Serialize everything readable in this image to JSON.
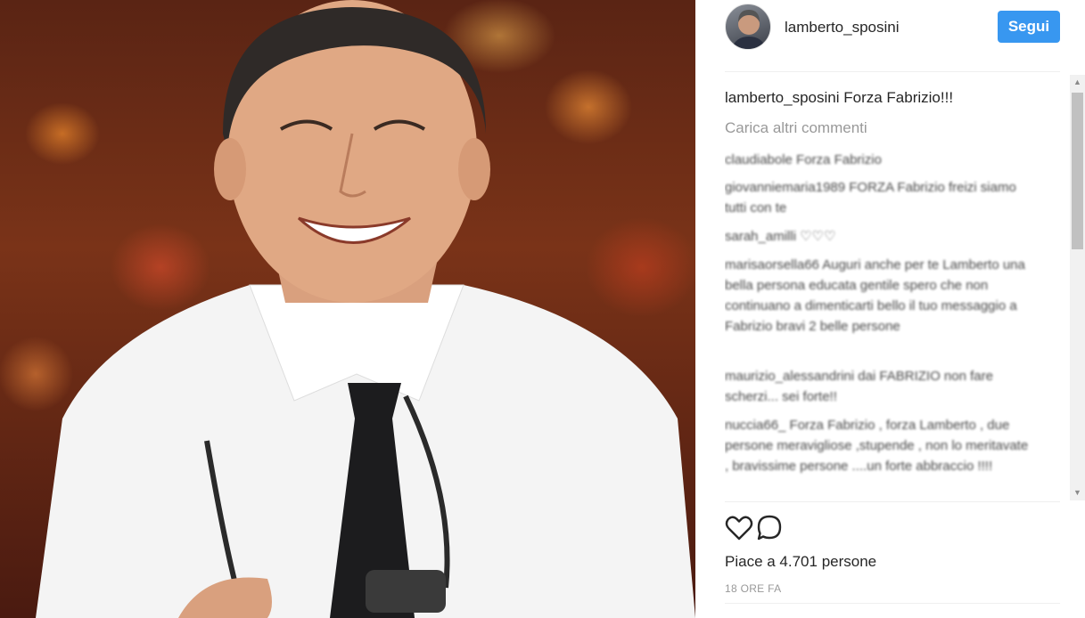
{
  "post": {
    "username": "lamberto_sposini",
    "follow_label": "Segui",
    "caption_user": "lamberto_sposini",
    "caption_text": "Forza Fabrizio!!!",
    "load_more_label": "Carica altri commenti",
    "likes_text": "Piace a 4.701 persone",
    "time_text": "18 ORE FA"
  },
  "comments": [
    {
      "text": "claudiabole Forza Fabrizio"
    },
    {
      "text": "giovanniemaria1989 FORZA Fabrizio freizi siamo tutti con te"
    },
    {
      "text": "sarah_amilli ♡♡♡"
    },
    {
      "text": "marisaorsella66 Auguri anche per te Lamberto una bella persona educata gentile spero che non continuano a dimenticarti bello il tuo messaggio a Fabrizio bravi 2 belle persone"
    },
    {
      "text": "maurizio_alessandrini dai FABRIZIO non fare scherzi... sei forte!!"
    },
    {
      "text": "nuccia66_ Forza Fabrizio , forza Lamberto , due persone meravigliose ,stupende , non lo meritavate , bravissime persone ....un forte abbraccio !!!!"
    }
  ],
  "icons": {
    "like": "heart-icon",
    "comment": "comment-icon",
    "scroll_up": "scroll-up-arrow-icon",
    "scroll_down": "scroll-down-arrow-icon"
  },
  "colors": {
    "accent": "#3897f0",
    "text": "#262626",
    "muted": "#999999"
  }
}
